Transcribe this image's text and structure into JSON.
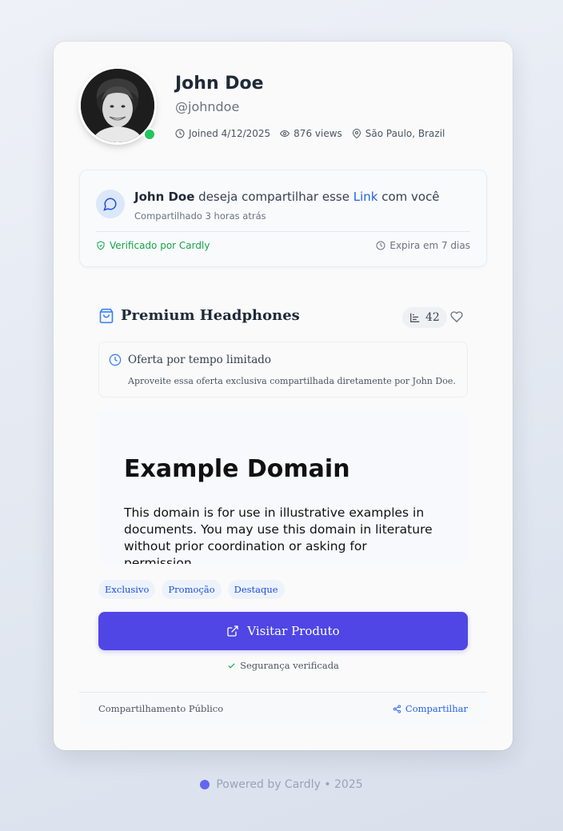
{
  "profile": {
    "name": "John Doe",
    "handle": "@johndoe",
    "joined": "Joined 4/12/2025",
    "views": "876 views",
    "location": "São Paulo, Brazil",
    "online": true
  },
  "share": {
    "sender": "John Doe",
    "message_before": " deseja compartilhar esse ",
    "link_label": "Link",
    "message_after": " com você",
    "time": "Compartilhado 3 horas atrás",
    "verified": "Verificado por Cardly",
    "expires": "Expira em 7 dias"
  },
  "product": {
    "title": "Premium Headphones",
    "stat_count": "42",
    "offer_title": "Oferta por tempo limitado",
    "offer_desc": "Aproveite essa oferta exclusiva compartilhada diretamente por John Doe.",
    "preview_heading": "Example Domain",
    "preview_text": "This domain is for use in illustrative examples in documents. You may use this domain in literature without prior coordination or asking for permission.",
    "tags": [
      "Exclusivo",
      "Promoção",
      "Destaque"
    ],
    "visit_label": "Visitar Produto",
    "secure_label": "Segurança verificada"
  },
  "footer": {
    "visibility": "Compartilhamento Público",
    "share_label": "Compartilhar"
  },
  "powered": "Powered by Cardly • 2025",
  "colors": {
    "accent": "#4f46e5",
    "link": "#2563eb",
    "success": "#22c55e"
  }
}
